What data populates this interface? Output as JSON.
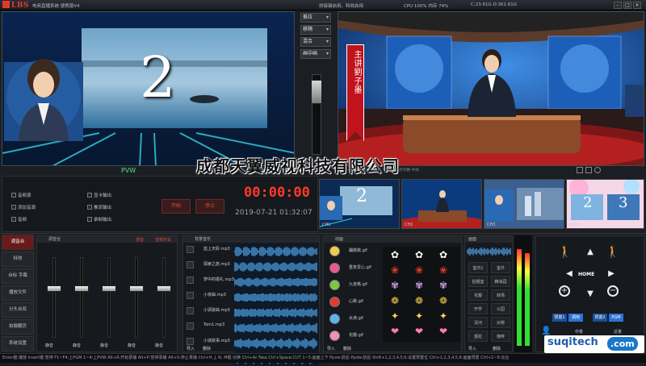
{
  "app": {
    "logo": "LBS",
    "title": "电商直播系统 便携版V4",
    "notice": "拼接键启用，特效启用",
    "stats": "CPU 100% 内存 74%",
    "disk": "C:23.61G D:361.61G"
  },
  "switcher": {
    "buttons": [
      "推拉",
      "移隔",
      "混合",
      "画中画"
    ]
  },
  "preview": {
    "label": "PVW",
    "big_number": "2"
  },
  "program": {
    "banner": "主讲劉子墨"
  },
  "watermark": "成都天翼威视科技有限公司",
  "program_bar": {
    "hint": "——F1 主窗 '19SDP' 下按 F4 表示切换 中效",
    "icons": [
      "monitor-icon",
      "expand-icon",
      "settings-icon"
    ]
  },
  "controls": {
    "checks": [
      {
        "label": "音频源"
      },
      {
        "label": "添加音源"
      },
      {
        "label": "音频"
      },
      {
        "label": "显卡输出"
      },
      {
        "label": "推流输出"
      },
      {
        "label": "录制输出"
      }
    ],
    "start_label": "开始",
    "stop_label": "停止",
    "timer": "00:00:00",
    "datetime": "2019-07-21 01:32:07"
  },
  "thumbs": [
    {
      "label": "CH1",
      "number": "2"
    },
    {
      "label": "CH2",
      "number": ""
    },
    {
      "label": "CH3",
      "number": ""
    },
    {
      "label": "CH4",
      "number": "3"
    }
  ],
  "menu": {
    "items": [
      {
        "label": "调音台"
      },
      {
        "label": "特效"
      },
      {
        "label": "台标 字幕"
      },
      {
        "label": "播放文件"
      },
      {
        "label": "分头台双"
      },
      {
        "label": "拍摄翻页"
      },
      {
        "label": "系统设置"
      }
    ]
  },
  "mixer": {
    "title": "调音台",
    "tabs": [
      "混音",
      "音频开关"
    ],
    "channels": [
      {
        "label": "静音",
        "level": 0.62
      },
      {
        "label": "静音",
        "level": 0.62
      },
      {
        "label": "静音",
        "level": 0.62
      },
      {
        "label": "静音",
        "level": 0.62
      },
      {
        "label": "静音",
        "level": 0.62
      }
    ]
  },
  "bgmusic": {
    "title": "背景音乐",
    "tracks": [
      {
        "name": "蓝上天聆.mp3"
      },
      {
        "name": "探索之旅.mp3"
      },
      {
        "name": "梦中的婚礼.mp3"
      },
      {
        "name": "小夜曲.mp3"
      },
      {
        "name": "小调歌曲.mp3"
      },
      {
        "name": "Tom1.mp3"
      },
      {
        "name": "小城故事.mp3"
      },
      {
        "name": "春节喜庆.mp3"
      }
    ],
    "footer": [
      "导入",
      "删除"
    ]
  },
  "fx": {
    "title": "动画",
    "items": [
      {
        "name": "蹦跳跳.gif"
      },
      {
        "name": "重复爱心.gif"
      },
      {
        "name": "九宫格.gif"
      },
      {
        "name": "心跳.gif"
      },
      {
        "name": "水滴.gif"
      },
      {
        "name": "花瓣.gif"
      }
    ],
    "footer": [
      "导入",
      "删除"
    ]
  },
  "sources": {
    "title": "画面",
    "items": [
      "室内1",
      "室外",
      "拍摄室",
      "精油园",
      "花瓣",
      "转场",
      "开学",
      "公园",
      "清河",
      "对称",
      "烟花",
      "咖啡"
    ],
    "footer": [
      "导入",
      "删除"
    ]
  },
  "ptz": {
    "home_label": "HOME",
    "bottom_buttons": [
      "预置1",
      "调用",
      "预置2",
      "PGM"
    ],
    "presets": [
      "中景",
      "近景"
    ]
  },
  "brand": {
    "name": "suqitech",
    "domain": ".com"
  },
  "statusbar": "Enter键:播放 Insert键:暂停 F1~F4:上PGM 1~4:上PVW Alt+R:开始录播 Alt+P:暂停录播 Alt+S:停止录播 Ctrl+H, J, N, M键:切换 Ctrl+Ar:Take Ctrl+Space:CUT 1~5:画面上下 Ppvw:前后 Ppdw:前后 Shift+1,2,3,4,5,6:设置预置位 Ctrl+1,2,3,4,5,6:画面预置 Ctrl+1~9:云台"
}
